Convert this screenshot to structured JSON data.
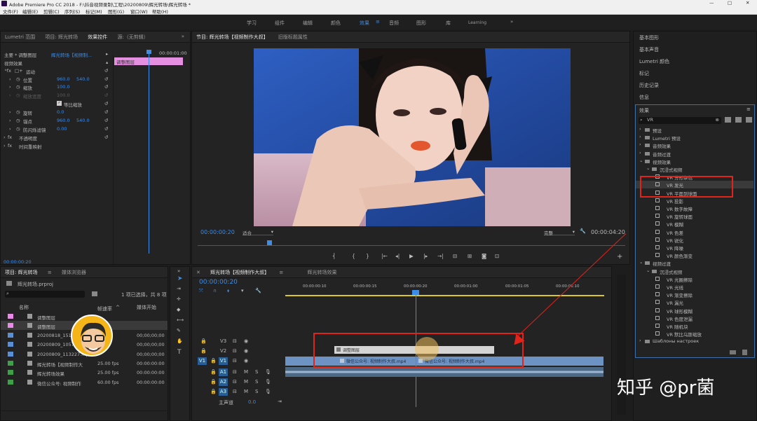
{
  "titlebar": {
    "title": "Adobe Premiere Pro CC 2018 - F:\\抖音视频录制\\工程\\20200809\\辉光转场\\辉光转场 *",
    "min": "—",
    "max": "□",
    "close": "✕"
  },
  "menu": [
    "文件(F)",
    "编辑(E)",
    "剪辑(C)",
    "序列(S)",
    "标记(M)",
    "图形(G)",
    "窗口(W)",
    "帮助(H)"
  ],
  "workspaces": {
    "items": [
      "学习",
      "组件",
      "编辑",
      "颜色",
      "效果",
      "音频",
      "图形",
      "库",
      "Learning"
    ],
    "active": "效果",
    "more": "»"
  },
  "effect_controls": {
    "tabs": [
      "Lumetri 范围",
      "项目: 辉光转场",
      "效果控件",
      "源:（无剪辑）"
    ],
    "more": "»",
    "clip_source": "主要 * 调整图层",
    "clip_seq": "辉光转场【视频制...",
    "timecode": "00:00:01:00",
    "clip_label": "调整图层",
    "video_effects": "视频效果",
    "motion": "运动",
    "props": [
      {
        "name": "位置",
        "v1": "960.0",
        "v2": "540.0"
      },
      {
        "name": "缩放",
        "v1": "100.0",
        "v2": ""
      },
      {
        "name": "缩放宽度",
        "v1": "100.0",
        "v2": ""
      },
      {
        "name": "等比缩放",
        "v1": "",
        "v2": ""
      },
      {
        "name": "旋转",
        "v1": "0.0",
        "v2": ""
      },
      {
        "name": "锚点",
        "v1": "960.0",
        "v2": "540.0"
      },
      {
        "name": "防闪烁滤镜",
        "v1": "0.00",
        "v2": ""
      }
    ],
    "opacity": "不透明度",
    "time_remap": "时间重映射",
    "bottom_tc": "00:00:00:20"
  },
  "program": {
    "tabs": [
      "节目: 辉光转场【视频制作大叔】",
      "旧版标题属性"
    ],
    "timecode": "00:00:00:20",
    "fit": "适合",
    "quality": "完整",
    "duration": "00:00:04:20",
    "add": "+"
  },
  "project": {
    "tabs": [
      "项目: 辉光转场",
      "媒体浏览器"
    ],
    "filename": "辉光转场.prproj",
    "selected_info": "1 项已选择，共 8 项",
    "search_placeholder": "",
    "col_name": "名称",
    "col_fps": "帧速率",
    "col_start": "媒体开始",
    "items": [
      {
        "name": "调整图层",
        "fps": "",
        "start": "",
        "color": "#e78be7"
      },
      {
        "name": "调整图层",
        "fps": "",
        "start": "",
        "color": "#e78be7"
      },
      {
        "name": "20200818_151807.mp4",
        "fps": "",
        "start": "00;00;00;00",
        "color": "#5a8fd6"
      },
      {
        "name": "20200809_105745.mp4",
        "fps": "",
        "start": "00;00;00;00",
        "color": "#5a8fd6"
      },
      {
        "name": "20200809_113227.mp4",
        "fps": "",
        "start": "00;00;00;00",
        "color": "#5a8fd6"
      },
      {
        "name": "辉光转场【视频制作大",
        "fps": "25.00 fps",
        "start": "00:00:00:00",
        "color": "#3ea049"
      },
      {
        "name": "辉光转场效果",
        "fps": "25.00 fps",
        "start": "00:00:00:00",
        "color": "#3ea049"
      },
      {
        "name": "微信公众号: 视频制作",
        "fps": "60.00 fps",
        "start": "00:00:00:00",
        "color": "#3ea049"
      }
    ]
  },
  "timeline": {
    "tabs": [
      "辉光转场【视频制作大叔】",
      "辉光转场效果"
    ],
    "timecode": "00:00:00:20",
    "ruler": [
      "00:00:00:10",
      "00:00:00:15",
      "00:00:00:20",
      "00:00:01:00",
      "00:00:01:05",
      "00:00:01:10"
    ],
    "tracks": [
      {
        "id": "V3",
        "src": ""
      },
      {
        "id": "V2",
        "src": ""
      },
      {
        "id": "V1",
        "src": "V1"
      },
      {
        "id": "A1",
        "src": ""
      },
      {
        "id": "A2",
        "src": ""
      },
      {
        "id": "A3",
        "src": ""
      }
    ],
    "master": "主声道",
    "master_val": "0.0",
    "adj_clip": "调整图层",
    "clip1": "微信公众号: 视频制作大叔.mp4",
    "clip2": "微信公众号: 视频制作大叔.mp4"
  },
  "right_panel": {
    "items": [
      "基本图形",
      "基本声音",
      "Lumetri 颜色",
      "标记",
      "历史记录",
      "信息"
    ],
    "effects_title": "效果",
    "search_value": "VR",
    "tree": [
      {
        "label": "预设",
        "level": 0
      },
      {
        "label": "Lumetri 预设",
        "level": 0
      },
      {
        "label": "音频效果",
        "level": 0
      },
      {
        "label": "音频过渡",
        "level": 0
      },
      {
        "label": "视频效果",
        "level": 0,
        "open": true
      },
      {
        "label": "沉浸式视频",
        "level": 1,
        "open": true
      },
      {
        "label": "VR 分形杂色",
        "level": 2
      },
      {
        "label": "VR 发光",
        "level": 2,
        "sel": true
      },
      {
        "label": "VR 平面到球面",
        "level": 2
      },
      {
        "label": "VR 投影",
        "level": 2
      },
      {
        "label": "VR 数字故障",
        "level": 2
      },
      {
        "label": "VR 旋转球面",
        "level": 2
      },
      {
        "label": "VR 模糊",
        "level": 2
      },
      {
        "label": "VR 色差",
        "level": 2
      },
      {
        "label": "VR 锐化",
        "level": 2
      },
      {
        "label": "VR 降噪",
        "level": 2
      },
      {
        "label": "VR 颜色渐变",
        "level": 2
      },
      {
        "label": "视频过渡",
        "level": 0,
        "open": true
      },
      {
        "label": "沉浸式视频",
        "level": 1,
        "open": true
      },
      {
        "label": "VR 光圈擦除",
        "level": 2
      },
      {
        "label": "VR 光线",
        "level": 2
      },
      {
        "label": "VR 渐变擦除",
        "level": 2
      },
      {
        "label": "VR 漏光",
        "level": 2
      },
      {
        "label": "VR 球形模糊",
        "level": 2
      },
      {
        "label": "VR 色度泄漏",
        "level": 2
      },
      {
        "label": "VR 随机块",
        "level": 2
      },
      {
        "label": "VR 默比乌斯缩放",
        "level": 2
      },
      {
        "label": "Шаблоны настроек",
        "level": 0
      }
    ]
  },
  "watermark": "知乎 @pr菌"
}
